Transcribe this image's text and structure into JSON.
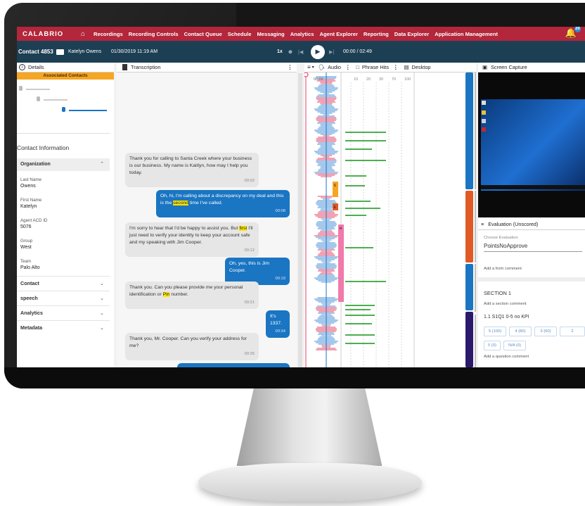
{
  "nav": {
    "logo": "CALABRIO",
    "items": [
      "Recordings",
      "Recording Controls",
      "Contact Queue",
      "Schedule",
      "Messaging",
      "Analytics",
      "Agent Explorer",
      "Reporting",
      "Data Explorer",
      "Application Management"
    ],
    "badge": "20"
  },
  "toolbar": {
    "contact_id": "Contact 4853",
    "agent": "Katelyn Owens",
    "datetime": "01/30/2019  11:19 AM",
    "speed": "1x",
    "time": "00:00 / 02:49"
  },
  "details": {
    "title": "Details",
    "associated": "Associated Contacts",
    "contact_info": "Contact Information",
    "organization": "Organization",
    "fields": [
      {
        "label": "Last Name",
        "value": "Owens"
      },
      {
        "label": "First Name",
        "value": "Katelyn"
      },
      {
        "label": "Agent ACD ID",
        "value": "5076"
      },
      {
        "label": "Group",
        "value": "West"
      },
      {
        "label": "Team",
        "value": "Palo Alto"
      }
    ],
    "sections": [
      "Contact",
      "speech",
      "Analytics",
      "Metadata"
    ]
  },
  "transcription": {
    "title": "Transcription",
    "messages": [
      {
        "side": "left",
        "text": "Thank you for calling to Santa Creek where your business is our business. My name is Kaitlyn, how may I help you today.",
        "time": "00:02"
      },
      {
        "side": "right",
        "pre": "Oh, hi, I'm calling about a discrepancy on my deal and this is the ",
        "hl": "second",
        "post": " time I've called.",
        "time": "00:08"
      },
      {
        "side": "left",
        "pre": "I'm sorry to hear that I'd be happy to assist you. But ",
        "hl": "first",
        "post": " I'll just need to verify your identity to keep your account safe and my speaking with Jim Cooper.",
        "time": "00:12"
      },
      {
        "side": "right",
        "text": "Oh, yes, this is Jim Cooper.",
        "time": "00:19"
      },
      {
        "side": "left",
        "pre": "Thank you. Can you please provide me your personal identification or ",
        "hl": "Pin",
        "post": " number.",
        "time": "00:21"
      },
      {
        "side": "right",
        "text": "It's 1337.",
        "time": "00:34"
      },
      {
        "side": "left",
        "text": "Thank you, Mr. Cooper. Can you verify your address for me?",
        "time": "00:26"
      }
    ]
  },
  "wave": {
    "audio": "Audio",
    "phrase_hits": "Phrase Hits",
    "desktop": "Desktop",
    "start": "00:00",
    "ticks": [
      "10",
      "20",
      "30",
      "70",
      "100"
    ],
    "markers": [
      {
        "label": "S",
        "color": "#f5a623"
      },
      {
        "label": "E",
        "color": "#e05a26"
      },
      {
        "label": "H",
        "color": "#f07aa9"
      }
    ],
    "lane_colors": [
      "#1a75c2",
      "#e05a26",
      "#1a75c2",
      "#2b1a6b",
      "#c0c0c0"
    ]
  },
  "screencap": {
    "title": "Screen Capture",
    "eval_title": "Evaluation (Unscored)",
    "choose_label": "Choose Evaluation",
    "choose_value": "PointsNoApprove",
    "form_comment": "Add a form comment",
    "section": "SECTION 1",
    "section_comment": "Add a section comment",
    "question": "1.1 S1Q1 0-5 no KPI",
    "options": [
      "5 (100)",
      "4 (80)",
      "3 (60)",
      "2",
      "0 (0)",
      "N/A (0)"
    ],
    "question_comment": "Add a question comment"
  }
}
